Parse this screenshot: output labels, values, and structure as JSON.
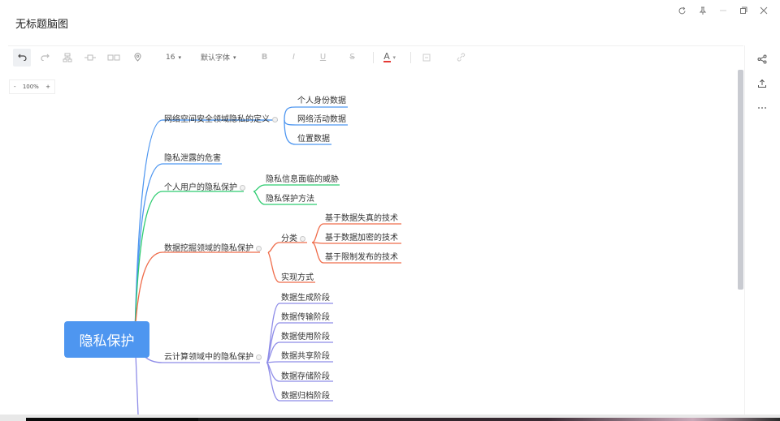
{
  "window": {
    "title": "无标题脑图",
    "controls": [
      "refresh-icon",
      "pin-icon",
      "minimize-icon",
      "maximize-icon",
      "close-icon"
    ]
  },
  "toolbar": {
    "font_size": "16",
    "font_family": "默认字体",
    "bold": "B",
    "italic": "I",
    "underline": "U",
    "strikethrough": "S",
    "font_color_label": "A",
    "font_color": "#e53935"
  },
  "zoom": {
    "minus": "-",
    "level": "100%",
    "plus": "+"
  },
  "colors": {
    "root_bg": "#4e96f0",
    "branch_blue": "#4e96f0",
    "branch_green": "#2ecc71",
    "branch_red": "#ef6c4a",
    "branch_purple": "#8e8ce8"
  },
  "mindmap": {
    "root": "隐私保护",
    "branches": [
      {
        "label": "网络空间安全领域隐私的定义",
        "children": [
          "个人身份数据",
          "网络活动数据",
          "位置数据"
        ]
      },
      {
        "label": "隐私泄露的危害",
        "children": []
      },
      {
        "label": "个人用户的隐私保护",
        "children": [
          "隐私信息面临的威胁",
          "隐私保护方法"
        ]
      },
      {
        "label": "数据挖掘领域的隐私保护",
        "children": [
          {
            "label": "分类",
            "children": [
              "基于数据失真的技术",
              "基于数据加密的技术",
              "基于限制发布的技术"
            ]
          },
          {
            "label": "实现方式",
            "children": []
          }
        ]
      },
      {
        "label": "云计算领域中的隐私保护",
        "children": [
          "数据生成阶段",
          "数据传输阶段",
          "数据使用阶段",
          "数据共享阶段",
          "数据存储阶段",
          "数据归档阶段"
        ]
      }
    ]
  }
}
